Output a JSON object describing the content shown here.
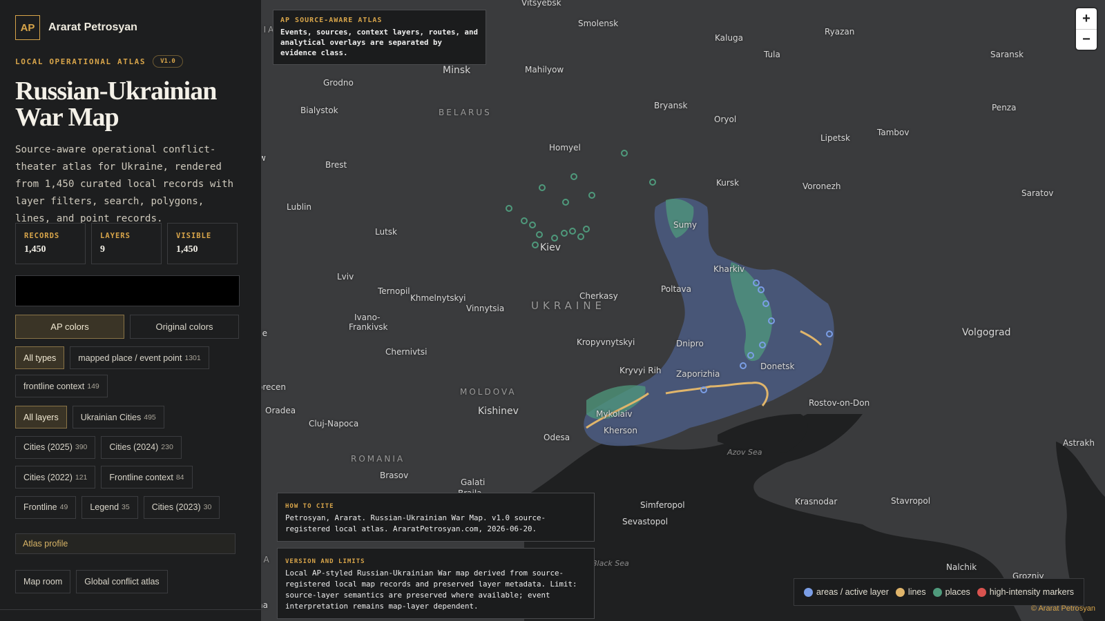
{
  "brand": {
    "mark": "AP",
    "name": "Ararat Petrosyan"
  },
  "eyebrow": "LOCAL OPERATIONAL ATLAS",
  "version": "V1.0",
  "title": "Russian-Ukrainian War Map",
  "description": "Source-aware operational conflict-theater atlas for Ukraine, rendered from 1,450 curated local records with layer filters, search, polygons, lines, and point records.",
  "stats": [
    {
      "label": "RECORDS",
      "value": "1,450"
    },
    {
      "label": "LAYERS",
      "value": "9"
    },
    {
      "label": "VISIBLE",
      "value": "1,450"
    }
  ],
  "search": {
    "value": "",
    "placeholder": ""
  },
  "color_modes": [
    {
      "label": "AP colors",
      "active": true
    },
    {
      "label": "Original colors",
      "active": false
    }
  ],
  "type_filters": [
    {
      "label": "All types",
      "count": "",
      "active": true
    },
    {
      "label": "mapped place / event point",
      "count": "1301",
      "active": false
    },
    {
      "label": "frontline context",
      "count": "149",
      "active": false
    }
  ],
  "layer_filters": [
    {
      "label": "All layers",
      "count": "",
      "active": true
    },
    {
      "label": "Ukrainian Cities",
      "count": "495",
      "active": false
    },
    {
      "label": "Cities (2025)",
      "count": "390",
      "active": false
    },
    {
      "label": "Cities (2024)",
      "count": "230",
      "active": false
    },
    {
      "label": "Cities (2022)",
      "count": "121",
      "active": false
    },
    {
      "label": "Frontline context",
      "count": "84",
      "active": false
    },
    {
      "label": "Frontline",
      "count": "49",
      "active": false
    },
    {
      "label": "Legend",
      "count": "35",
      "active": false
    },
    {
      "label": "Cities (2023)",
      "count": "30",
      "active": false
    }
  ],
  "profile_link": "Atlas profile",
  "bottom_links": [
    "Map room",
    "Global conflict atlas"
  ],
  "atlas_card": {
    "title": "AP SOURCE-AWARE ATLAS",
    "text": "Events, sources, context layers, routes, and analytical overlays are separated by evidence class."
  },
  "cite_card": {
    "title": "HOW TO CITE",
    "text": "Petrosyan, Ararat. Russian-Ukrainian War Map. v1.0 source-registered local atlas. AraratPetrosyan.com, 2026-06-20."
  },
  "limits_card": {
    "title": "VERSION AND LIMITS",
    "text": "Local AP-styled Russian-Ukrainian War map derived from source-registered local map records and preserved layer metadata. Limit: source-layer semantics are preserved where available; event interpretation remains map-layer dependent."
  },
  "zoom": {
    "in": "+",
    "out": "−"
  },
  "legend": [
    {
      "label": "areas / active layer",
      "color": "#7b9ee6"
    },
    {
      "label": "lines",
      "color": "#e0b56b"
    },
    {
      "label": "places",
      "color": "#4f9a7c"
    },
    {
      "label": "high-intensity markers",
      "color": "#d9534f"
    }
  ],
  "copyright": "© Ararat Petrosyan",
  "map_labels": {
    "vitsyebsk": "Vitsyebsk",
    "smolensk": "Smolensk",
    "kaluga": "Kaluga",
    "ryazan": "Ryazan",
    "tula": "Tula",
    "saransk": "Saransk",
    "minsk": "Minsk",
    "mahilyow": "Mahilyow",
    "grodno": "Grodno",
    "bialystok": "Bialystok",
    "belarus": "BELARUS",
    "bryansk": "Bryansk",
    "oryol": "Oryol",
    "penza": "Penza",
    "tambov": "Tambov",
    "lipetsk": "Lipetsk",
    "homyel": "Homyel",
    "brest": "Brest",
    "kursk": "Kursk",
    "voronezh": "Voronezh",
    "saratov": "Saratov",
    "lublin": "Lublin",
    "lutsk": "Lutsk",
    "sumy": "Sumy",
    "kiev": "Kiev",
    "kharkiv": "Kharkiv",
    "lviv": "Lviv",
    "ternopil": "Ternopil",
    "khmelnytskyi": "Khmelnytskyi",
    "cherkasy": "Cherkasy",
    "poltava": "Poltava",
    "vinnytsia": "Vinnytsia",
    "ukraine": "UKRAINE",
    "ivano": "Ivano-",
    "frankivsk": "Frankivsk",
    "volgograd": "Volgograd",
    "kropyvnytskyi": "Kropyvnytskyi",
    "dnipro": "Dnipro",
    "chernivtsi": "Chernivtsi",
    "kryvyi_rih": "Kryvyi Rih",
    "zaporizhia": "Zaporizhia",
    "donetsk": "Donetsk",
    "moldova": "MOLDOVA",
    "kishinev": "Kishinev",
    "oradea": "Oradea",
    "cluj": "Cluj-Napoca",
    "mykolaiv": "Mykolaiv",
    "kherson": "Kherson",
    "rostov": "Rostov-on-Don",
    "odesa": "Odesa",
    "romania": "ROMANIA",
    "azov": "Azov Sea",
    "brasov": "Brasov",
    "galati": "Galati",
    "braila": "Braila",
    "astrakhan": "Astrakh",
    "simferopol": "Simferopol",
    "krasnodar": "Krasnodar",
    "stavropol": "Stavropol",
    "sevastopol": "Sevastopol",
    "black_sea": "Black Sea",
    "nalchik": "Nalchik",
    "grozny": "Grozniy",
    "edge_sia": "SIA",
    "edge_w": "w",
    "edge_ce": "ce",
    "edge_orecen": "orecen",
    "edge_ia": "IA",
    "edge_na": "na"
  }
}
